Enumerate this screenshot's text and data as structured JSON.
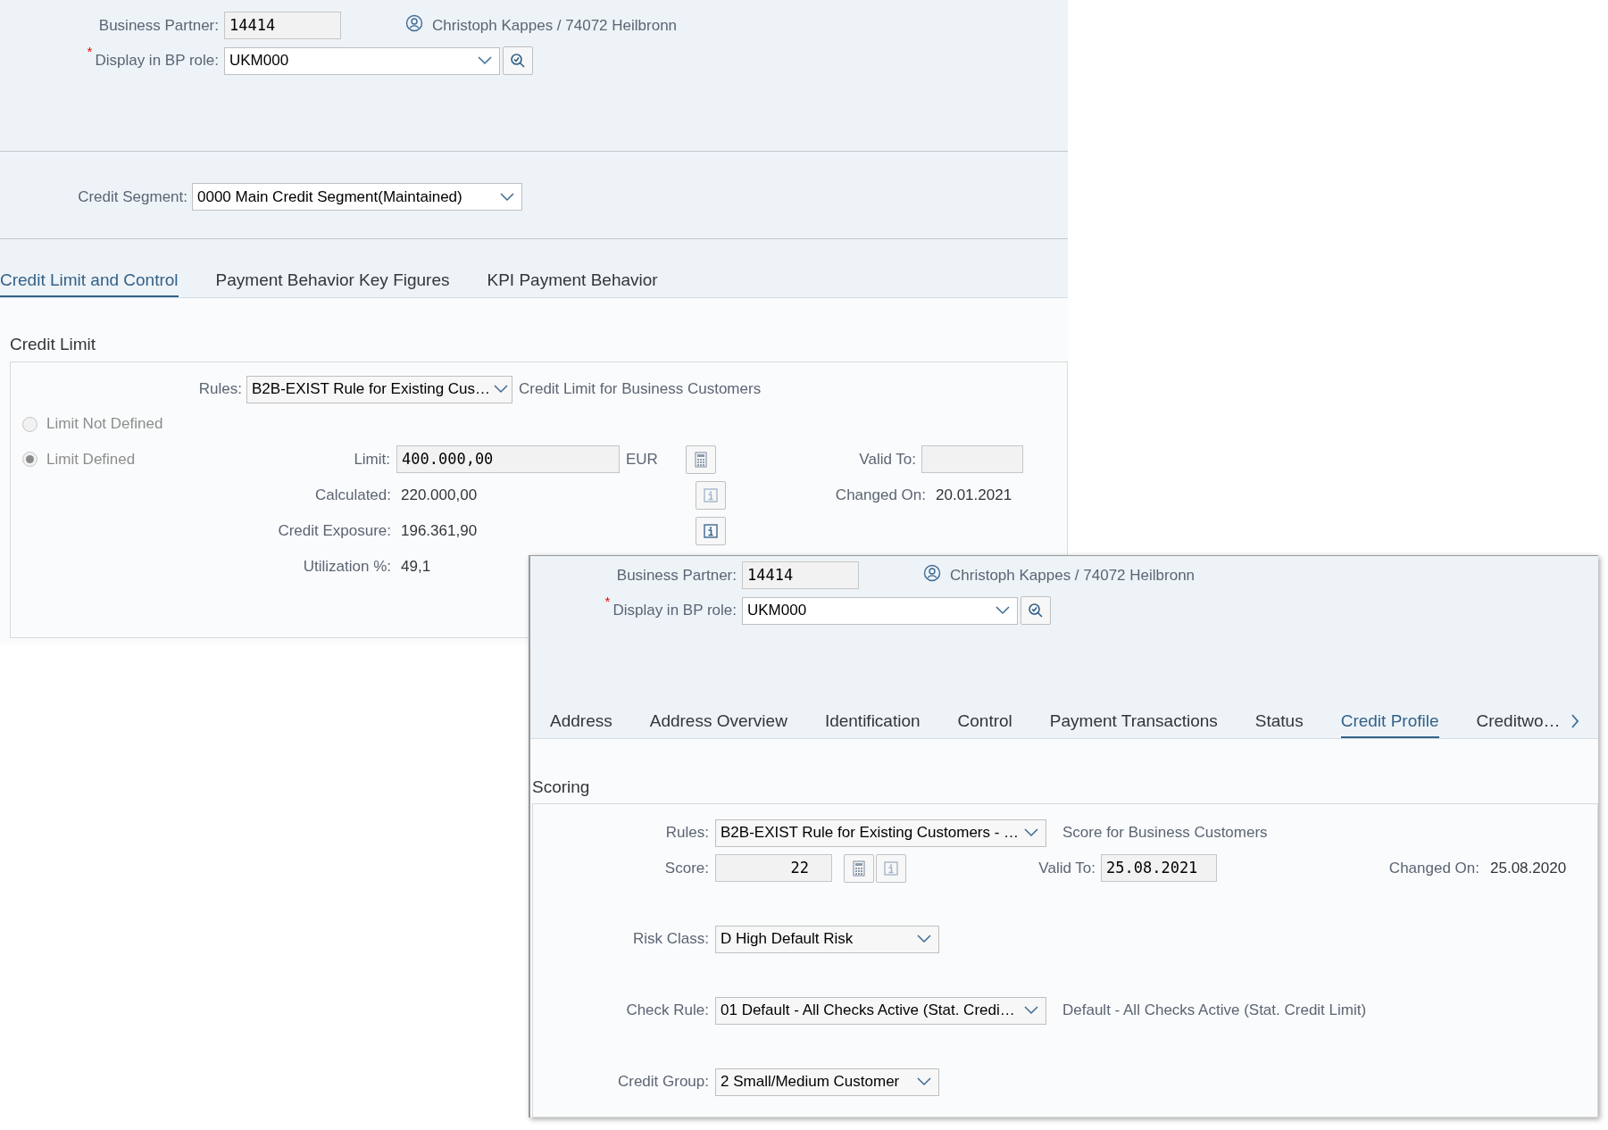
{
  "back_window": {
    "business_partner": {
      "label": "Business Partner:",
      "value": "14414",
      "partner_name": "Christoph Kappes / 74072 Heilbronn"
    },
    "bp_role": {
      "label": "Display in BP role:",
      "required_mark": "*",
      "value": "UKM000"
    },
    "credit_segment": {
      "label": "Credit Segment:",
      "value": "0000 Main Credit Segment(Maintained)"
    },
    "tabs": [
      {
        "label": "Credit Limit and Control",
        "selected": true
      },
      {
        "label": "Payment Behavior Key Figures",
        "selected": false
      },
      {
        "label": "KPI Payment Behavior",
        "selected": false
      }
    ],
    "credit_limit": {
      "title": "Credit Limit",
      "rules": {
        "label": "Rules:",
        "value": "B2B-EXIST Rule for Existing Cus…",
        "description": "Credit Limit for Business Customers"
      },
      "options": [
        {
          "label": "Limit Not Defined",
          "selected": false
        },
        {
          "label": "Limit Defined",
          "selected": true
        }
      ],
      "limit": {
        "label": "Limit:",
        "value": "400.000,00",
        "currency": "EUR"
      },
      "calculated": {
        "label": "Calculated:",
        "value": "220.000,00",
        "info_disabled": true
      },
      "credit_exposure": {
        "label": "Credit Exposure:",
        "value": "196.361,90",
        "info_disabled": false
      },
      "utilization": {
        "label": "Utilization %:",
        "value": "49,1"
      },
      "valid_to": {
        "label": "Valid To:"
      },
      "changed_on": {
        "label": "Changed On:",
        "value": "20.01.2021"
      }
    }
  },
  "front_window": {
    "business_partner": {
      "label": "Business Partner:",
      "value": "14414",
      "partner_name": "Christoph Kappes / 74072 Heilbronn"
    },
    "bp_role": {
      "label": "Display in BP role:",
      "required_mark": "*",
      "value": "UKM000"
    },
    "tabs": [
      {
        "label": "Address",
        "selected": false
      },
      {
        "label": "Address Overview",
        "selected": false
      },
      {
        "label": "Identification",
        "selected": false
      },
      {
        "label": "Control",
        "selected": false
      },
      {
        "label": "Payment Transactions",
        "selected": false
      },
      {
        "label": "Status",
        "selected": false
      },
      {
        "label": "Credit Profile",
        "selected": true
      },
      {
        "label": "Creditwo…",
        "selected": false
      }
    ],
    "scoring": {
      "title": "Scoring",
      "rules": {
        "label": "Rules:",
        "value": "B2B-EXIST Rule for Existing Customers - …",
        "description": "Score for Business Customers"
      },
      "score": {
        "label": "Score:",
        "value": "22"
      },
      "valid_to": {
        "label": "Valid To:",
        "value": "25.08.2021"
      },
      "changed_on": {
        "label": "Changed On:",
        "value": "25.08.2020"
      },
      "risk_class": {
        "label": "Risk Class:",
        "value": "D High Default Risk"
      },
      "check_rule": {
        "label": "Check Rule:",
        "value": "01 Default - All Checks Active (Stat. Credi…",
        "description": "Default - All Checks Active (Stat. Credit Limit)"
      },
      "credit_group": {
        "label": "Credit Group:",
        "value": "2 Small/Medium Customer"
      }
    }
  }
}
